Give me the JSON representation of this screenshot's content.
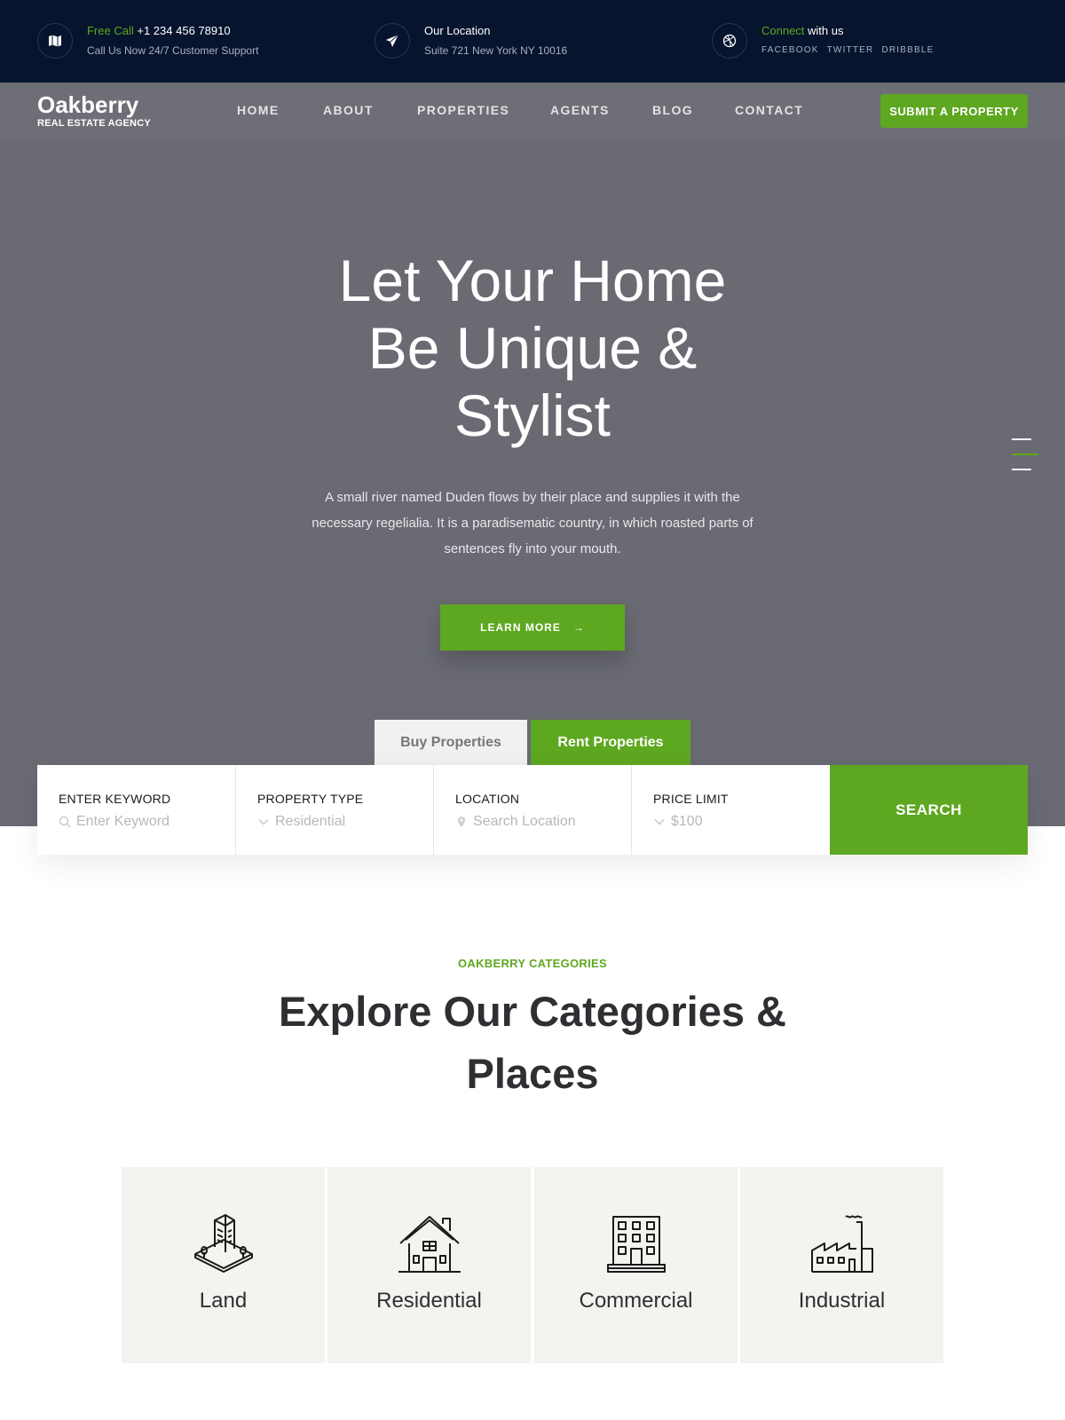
{
  "topbar": {
    "call": {
      "accent": "Free Call",
      "phone": "+1 234 456 78910",
      "sub": "Call Us Now 24/7 Customer Support",
      "icon": "map-icon"
    },
    "location": {
      "title": "Our Location",
      "sub": "Suite 721 New York NY 10016",
      "icon": "paper-plane-icon"
    },
    "connect": {
      "accent": "Connect",
      "rest": " with us",
      "social": [
        "FACEBOOK",
        "TWITTER",
        "DRIBBBLE"
      ],
      "icon": "dribbble-icon"
    }
  },
  "nav": {
    "logo_name": "Oakberry",
    "logo_sub": "REAL ESTATE AGENCY",
    "items": [
      "HOME",
      "ABOUT",
      "PROPERTIES",
      "AGENTS",
      "BLOG",
      "CONTACT"
    ],
    "cta": "SUBMIT A PROPERTY"
  },
  "hero": {
    "title_lines": [
      "Let Your Home",
      "Be Unique &",
      "Stylist"
    ],
    "desc_lines": [
      "A small river named Duden flows by their place and supplies it with the",
      "necessary regelialia. It is a paradisematic country, in which roasted parts of",
      "sentences fly into your mouth."
    ],
    "button": "LEARN MORE",
    "button_arrow": "→"
  },
  "tabs": {
    "buy": "Buy Properties",
    "rent": "Rent Properties"
  },
  "search": {
    "fields": [
      {
        "label": "ENTER KEYWORD",
        "value": "Enter Keyword",
        "icon": "search-icon"
      },
      {
        "label": "PROPERTY TYPE",
        "value": "Residential",
        "icon": "chevron-down-icon"
      },
      {
        "label": "LOCATION",
        "value": "Search Location",
        "icon": "location-pin-icon"
      },
      {
        "label": "PRICE LIMIT",
        "value": "$100",
        "icon": "chevron-down-icon"
      }
    ],
    "button": "SEARCH"
  },
  "categories": {
    "eyebrow": "OAKBERRY CATEGORIES",
    "title_lines": [
      "Explore Our Categories &",
      "Places"
    ],
    "items": [
      {
        "name": "Land",
        "icon": "building-land-icon"
      },
      {
        "name": "Residential",
        "icon": "house-icon"
      },
      {
        "name": "Commercial",
        "icon": "office-building-icon"
      },
      {
        "name": "Industrial",
        "icon": "factory-icon"
      }
    ]
  },
  "colors": {
    "accent": "#5ea720",
    "topbar": "#07142e",
    "navbar": "#6e6e76",
    "hero": "#696a72",
    "card": "#f3f3ef"
  }
}
